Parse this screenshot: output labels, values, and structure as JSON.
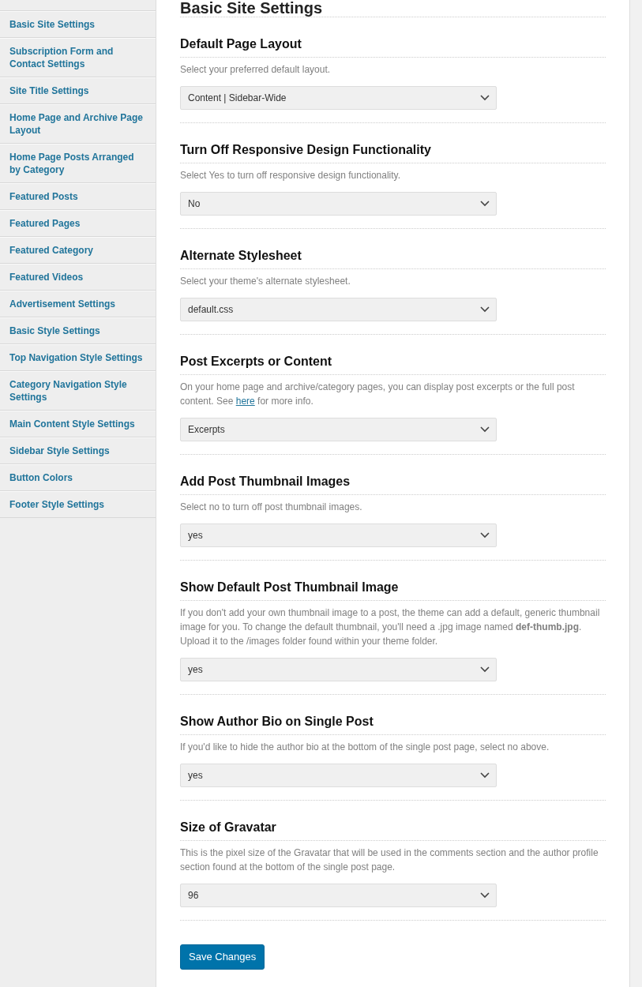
{
  "sidebar": {
    "items": [
      {
        "label": "Basic Site Settings"
      },
      {
        "label": "Subscription Form and Contact Settings"
      },
      {
        "label": "Site Title Settings"
      },
      {
        "label": "Home Page and Archive Page Layout"
      },
      {
        "label": "Home Page Posts Arranged by Category"
      },
      {
        "label": "Featured Posts"
      },
      {
        "label": "Featured Pages"
      },
      {
        "label": "Featured Category"
      },
      {
        "label": "Featured Videos"
      },
      {
        "label": "Advertisement Settings"
      },
      {
        "label": "Basic Style Settings"
      },
      {
        "label": "Top Navigation Style Settings"
      },
      {
        "label": "Category Navigation Style Settings"
      },
      {
        "label": "Main Content Style Settings"
      },
      {
        "label": "Sidebar Style Settings"
      },
      {
        "label": "Button Colors"
      },
      {
        "label": "Footer Style Settings"
      }
    ]
  },
  "page_title": "Basic Site Settings",
  "sections": [
    {
      "title": "Default Page Layout",
      "description": [
        {
          "text": "Select your preferred default layout."
        }
      ],
      "value": "Content | Sidebar-Wide"
    },
    {
      "title": "Turn Off Responsive Design Functionality",
      "description": [
        {
          "text": "Select Yes to turn off responsive design functionality."
        }
      ],
      "value": "No"
    },
    {
      "title": "Alternate Stylesheet",
      "description": [
        {
          "text": "Select your theme's alternate stylesheet."
        }
      ],
      "value": "default.css"
    },
    {
      "title": "Post Excerpts or Content",
      "description": [
        {
          "text": "On your home page and archive/category pages, you can display post excerpts or the full post content. See "
        },
        {
          "link": "here"
        },
        {
          "text": " for more info."
        }
      ],
      "value": "Excerpts"
    },
    {
      "title": "Add Post Thumbnail Images",
      "description": [
        {
          "text": "Select no to turn off post thumbnail images."
        }
      ],
      "value": "yes"
    },
    {
      "title": "Show Default Post Thumbnail Image",
      "description": [
        {
          "text": "If you don't add your own thumbnail image to a post, the theme can add a default, generic thumbnail image for you. To change the default thumbnail, you'll need a .jpg image named **def-thumb.jpg**. Upload it to the /images folder found within your theme folder."
        }
      ],
      "value": "yes"
    },
    {
      "title": "Show Author Bio on Single Post",
      "description": [
        {
          "text": "If you'd like to hide the author bio at the bottom of the single post page, select no above."
        }
      ],
      "value": "yes"
    },
    {
      "title": "Size of Gravatar",
      "description": [
        {
          "text": "This is the pixel size of the Gravatar that will be used in the comments section and the author profile section found at the bottom of the single post page."
        }
      ],
      "value": "96"
    }
  ],
  "save_button": "Save Changes"
}
